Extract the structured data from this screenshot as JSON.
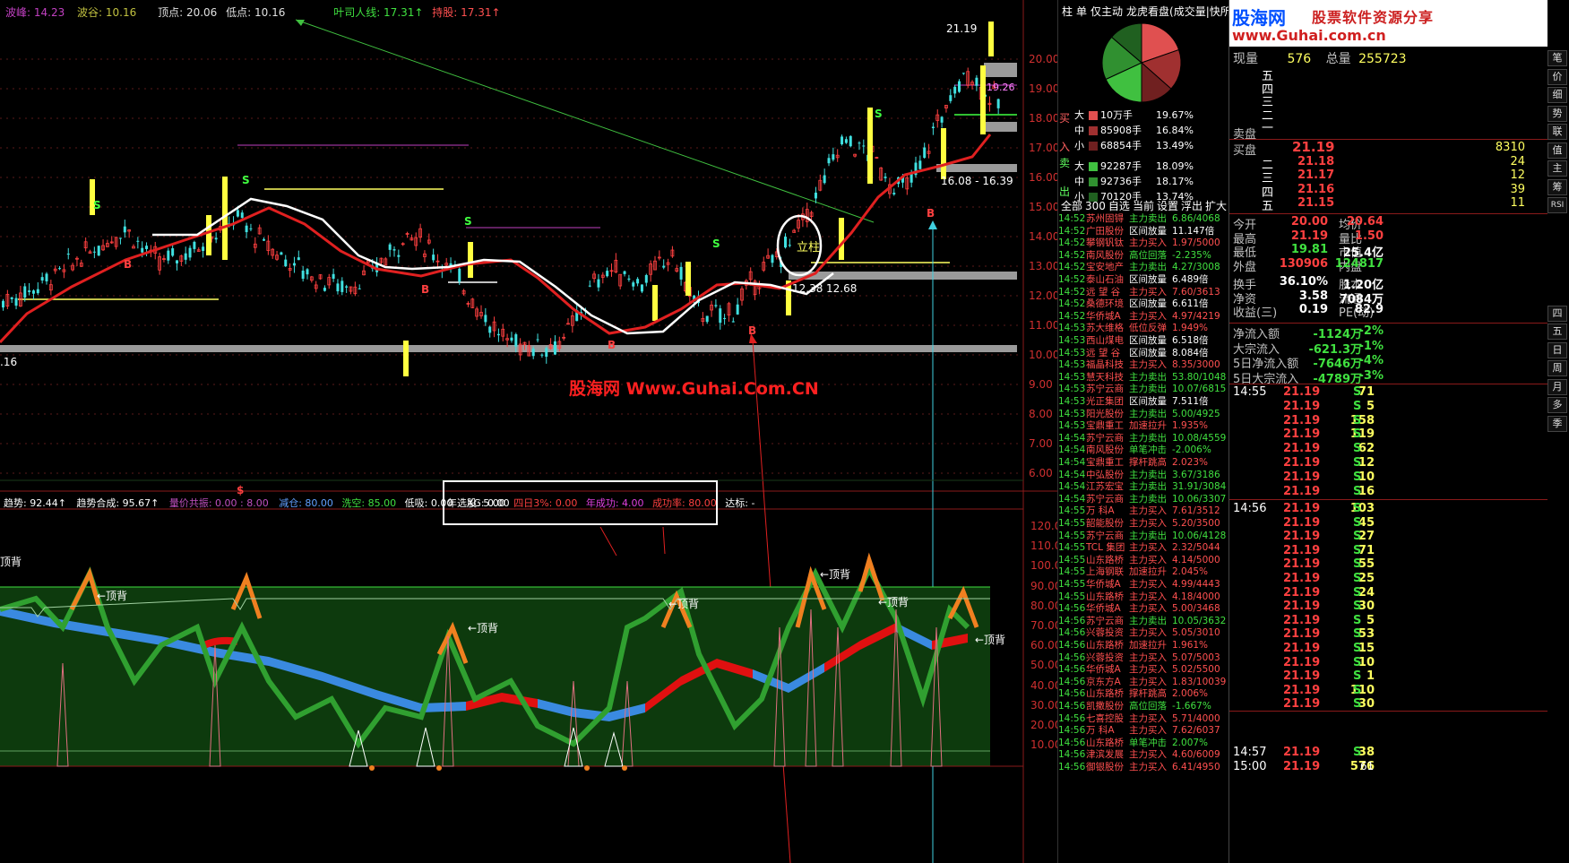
{
  "top_bar": {
    "wave_peak": "波峰: 14.23",
    "wave_trough": "波谷: 10.16",
    "top_point": "顶点: 20.06",
    "low_point": "低点: 10.16",
    "ye_line": "叶司人线: 17.31↑",
    "support": "持股: 17.31↑"
  },
  "price_axis": [
    "20.00",
    "19.00",
    "18.00",
    "17.00",
    "16.00",
    "15.00",
    "14.00",
    "13.00",
    "12.00",
    "11.00",
    "10.00",
    "9.00",
    "8.00",
    "7.00",
    "6.00"
  ],
  "indicator_axis": [
    "120.00",
    "110.00",
    "100.00",
    "90.00",
    "80.00",
    "70.00",
    "60.00",
    "50.00",
    "40.00",
    "30.00",
    "20.00",
    "10.00"
  ],
  "annotations": {
    "high_price": "21.19",
    "level_1926": "19.26",
    "range_label": "16.08 - 16.39",
    "low_1238": "12.38",
    "low_1268": "12.68",
    "left_level": ".16",
    "lizhu": "立柱",
    "watermark": "股海网 Www.Guhai.Com.CN",
    "top_back": "←顶背",
    "top_back_left": "顶背",
    "letter_s": "S",
    "letter_b": "B",
    "dollar": "$"
  },
  "indicator_bar": {
    "trend": "趋势: 92.44↑",
    "trend_comp": "趋势合成: 95.67↑",
    "vol_res": "量价共振: 0.00 : 8.00",
    "reduce": "减仓: 80.00",
    "wash": "洗空: 85.00",
    "low_suck": "低吸: 0.00",
    "xg": "XG: 0.00",
    "year_pick": "年选股: 5.00",
    "four_day": "四日3%: 0.00",
    "year_success": "年成功: 4.00",
    "success_rate": "成功率: 80.00",
    "target": "达标: -"
  },
  "right_panel": {
    "tabs": [
      "柱",
      "单",
      "仅主动",
      "龙虎看盘(成交量|快所有)"
    ],
    "buy_label": [
      "买",
      "入"
    ],
    "sell_label": [
      "卖",
      "出"
    ],
    "flow": [
      {
        "size": "大",
        "qty": "10万手",
        "pct": "19.67%",
        "color": "#e05050"
      },
      {
        "size": "中",
        "qty": "85908手",
        "pct": "16.84%",
        "color": "#a03030"
      },
      {
        "size": "小",
        "qty": "68854手",
        "pct": "13.49%",
        "color": "#702020"
      },
      {
        "size": "大",
        "qty": "92287手",
        "pct": "18.09%",
        "color": "#40c040"
      },
      {
        "size": "中",
        "qty": "92736手",
        "pct": "18.17%",
        "color": "#309030"
      },
      {
        "size": "小",
        "qty": "70120手",
        "pct": "13.74%",
        "color": "#206020"
      }
    ],
    "filter_tabs": [
      "全部",
      "300",
      "自选",
      "当前",
      "设置",
      "浮出",
      "扩大"
    ],
    "news": [
      [
        "14:52",
        "苏州固锝",
        "主力卖出",
        "6.86/4068"
      ],
      [
        "14:52",
        "广田股份",
        "区间放量",
        "11.147倍"
      ],
      [
        "14:52",
        "攀钢钒钛",
        "主力买入",
        "1.97/5000"
      ],
      [
        "14:52",
        "南风股份",
        "高位回落",
        "-2.235%"
      ],
      [
        "14:52",
        "宝安地产",
        "主力卖出",
        "4.27/3008"
      ],
      [
        "14:52",
        "泰山石油",
        "区间放量",
        "6.489倍"
      ],
      [
        "14:52",
        "远 望 谷",
        "主力买入",
        "7.60/3613"
      ],
      [
        "14:52",
        "桑德环境",
        "区间放量",
        "6.611倍"
      ],
      [
        "14:52",
        "华侨城A",
        "主力买入",
        "4.97/4219"
      ],
      [
        "14:53",
        "苏大维格",
        "低位反弹",
        "1.949%"
      ],
      [
        "14:53",
        "西山煤电",
        "区间放量",
        "6.518倍"
      ],
      [
        "14:53",
        "远 望 谷",
        "区间放量",
        "8.084倍"
      ],
      [
        "14:53",
        "福晶科技",
        "主力买入",
        "8.35/3000"
      ],
      [
        "14:53",
        "慧天科技",
        "主力卖出",
        "53.80/1048"
      ],
      [
        "14:53",
        "苏宁云商",
        "主力卖出",
        "10.07/6815"
      ],
      [
        "14:53",
        "光正集团",
        "区间放量",
        "7.511倍"
      ],
      [
        "14:53",
        "阳光股份",
        "主力卖出",
        "5.00/4925"
      ],
      [
        "14:53",
        "宝鼎重工",
        "加速拉升",
        "1.935%"
      ],
      [
        "14:54",
        "苏宁云商",
        "主力卖出",
        "10.08/4559"
      ],
      [
        "14:54",
        "南风股份",
        "单笔冲击",
        "-2.006%"
      ],
      [
        "14:54",
        "宝鼎重工",
        "撑杆跳高",
        "2.023%"
      ],
      [
        "14:54",
        "中弘股份",
        "主力卖出",
        "3.67/3186"
      ],
      [
        "14:54",
        "江苏宏宝",
        "主力卖出",
        "31.91/3084"
      ],
      [
        "14:54",
        "苏宁云商",
        "主力卖出",
        "10.06/3307"
      ],
      [
        "14:55",
        "万  科A",
        "主力买入",
        "7.61/3512"
      ],
      [
        "14:55",
        "韶能股份",
        "主力买入",
        "5.20/3500"
      ],
      [
        "14:55",
        "苏宁云商",
        "主力卖出",
        "10.06/4128"
      ],
      [
        "14:55",
        "TCL 集团",
        "主力买入",
        "2.32/5044"
      ],
      [
        "14:55",
        "山东路桥",
        "主力买入",
        "4.14/5000"
      ],
      [
        "14:55",
        "上海钢联",
        "加速拉升",
        "2.045%"
      ],
      [
        "14:55",
        "华侨城A",
        "主力买入",
        "4.99/4443"
      ],
      [
        "14:55",
        "山东路桥",
        "主力买入",
        "4.18/4000"
      ],
      [
        "14:56",
        "华侨城A",
        "主力买入",
        "5.00/3468"
      ],
      [
        "14:56",
        "苏宁云商",
        "主力卖出",
        "10.05/3632"
      ],
      [
        "14:56",
        "兴蓉投资",
        "主力买入",
        "5.05/3010"
      ],
      [
        "14:56",
        "山东路桥",
        "加速拉升",
        "1.961%"
      ],
      [
        "14:56",
        "兴蓉投资",
        "主力买入",
        "5.07/5003"
      ],
      [
        "14:56",
        "华侨城A",
        "主力买入",
        "5.02/5500"
      ],
      [
        "14:56",
        "京东方A",
        "主力买入",
        "1.83/10039"
      ],
      [
        "14:56",
        "山东路桥",
        "撑杆跳高",
        "2.006%"
      ],
      [
        "14:56",
        "凯撒股份",
        "高位回落",
        "-1.667%"
      ],
      [
        "14:56",
        "七喜控股",
        "主力买入",
        "5.71/4000"
      ],
      [
        "14:56",
        "万  科A",
        "主力买入",
        "7.62/6037"
      ],
      [
        "14:56",
        "山东路桥",
        "单笔冲击",
        "2.007%"
      ],
      [
        "14:56",
        "津滨发展",
        "主力买入",
        "4.60/6009"
      ],
      [
        "14:56",
        "御银股份",
        "主力买入",
        "6.41/4950"
      ]
    ]
  },
  "quote_panel": {
    "logo_text": "股海网",
    "logo_slogan": "股票软件资源分享",
    "logo_url": "www.Guhai.com.cn",
    "cur_vol_label": "现量",
    "cur_vol": "576",
    "total_vol_label": "总量",
    "total_vol": "255723",
    "sell_levels": [
      "五",
      "四",
      "三",
      "二",
      "一"
    ],
    "sell_label": "卖盘",
    "buy_label": "买盘",
    "buy_levels": [
      {
        "lvl": "一",
        "price": "21.19",
        "vol": "8310"
      },
      {
        "lvl": "二",
        "price": "21.18",
        "vol": "24"
      },
      {
        "lvl": "三",
        "price": "21.17",
        "vol": "12"
      },
      {
        "lvl": "四",
        "price": "21.16",
        "vol": "39"
      },
      {
        "lvl": "五",
        "price": "21.15",
        "vol": "11"
      }
    ],
    "stats": [
      [
        "今开",
        "20.00",
        "均价",
        "20.64"
      ],
      [
        "最高",
        "21.19",
        "量比",
        "1.50"
      ],
      [
        "最低",
        "19.81",
        "市值",
        "25.4亿"
      ],
      [
        "外盘",
        "130906",
        "内盘",
        "124817"
      ],
      [
        "换手",
        "36.10%",
        "股本",
        "1.20亿"
      ],
      [
        "净资",
        "3.58",
        "流通",
        "7084万"
      ],
      [
        "收益(三)",
        "0.19",
        "PE(动)",
        "82.9"
      ]
    ],
    "flows": [
      [
        "净流入额",
        "-1124万",
        "-2%"
      ],
      [
        "大宗流入",
        "-621.3万",
        "-1%"
      ],
      [
        "5日净流入额",
        "-7646万",
        "-4%"
      ],
      [
        "5日大宗流入",
        "-4789万",
        "-3%"
      ]
    ],
    "ticks_a_time": "14:55",
    "ticks_a": [
      [
        "21.19",
        "71",
        "S"
      ],
      [
        "21.19",
        "5",
        "S"
      ],
      [
        "21.19",
        "158",
        "S"
      ],
      [
        "21.19",
        "119",
        "S"
      ],
      [
        "21.19",
        "62",
        "S"
      ],
      [
        "21.19",
        "12",
        "S"
      ],
      [
        "21.19",
        "10",
        "S"
      ],
      [
        "21.19",
        "16",
        "S"
      ]
    ],
    "ticks_b_time": "14:56",
    "ticks_b": [
      [
        "21.19",
        "103",
        "S"
      ],
      [
        "21.19",
        "45",
        "S"
      ],
      [
        "21.19",
        "27",
        "S"
      ],
      [
        "21.19",
        "71",
        "S"
      ],
      [
        "21.19",
        "55",
        "S"
      ],
      [
        "21.19",
        "25",
        "S"
      ],
      [
        "21.19",
        "24",
        "S"
      ],
      [
        "21.19",
        "30",
        "S"
      ],
      [
        "21.19",
        "5",
        "S"
      ],
      [
        "21.19",
        "53",
        "S"
      ],
      [
        "21.19",
        "15",
        "S"
      ],
      [
        "21.19",
        "10",
        "S"
      ],
      [
        "21.19",
        "1",
        "S"
      ],
      [
        "21.19",
        "110",
        "S"
      ],
      [
        "21.19",
        "30",
        "S"
      ]
    ],
    "tick_c": [
      "14:57",
      "21.19",
      "38",
      "S"
    ],
    "tick_d": [
      "15:00",
      "21.19",
      "576",
      "61"
    ],
    "side_tabs": [
      "笔",
      "价",
      "细",
      "势",
      "联",
      "值",
      "主",
      "筹",
      "RSI",
      "四",
      "五",
      "日",
      "周",
      "月",
      "多",
      "季"
    ]
  }
}
